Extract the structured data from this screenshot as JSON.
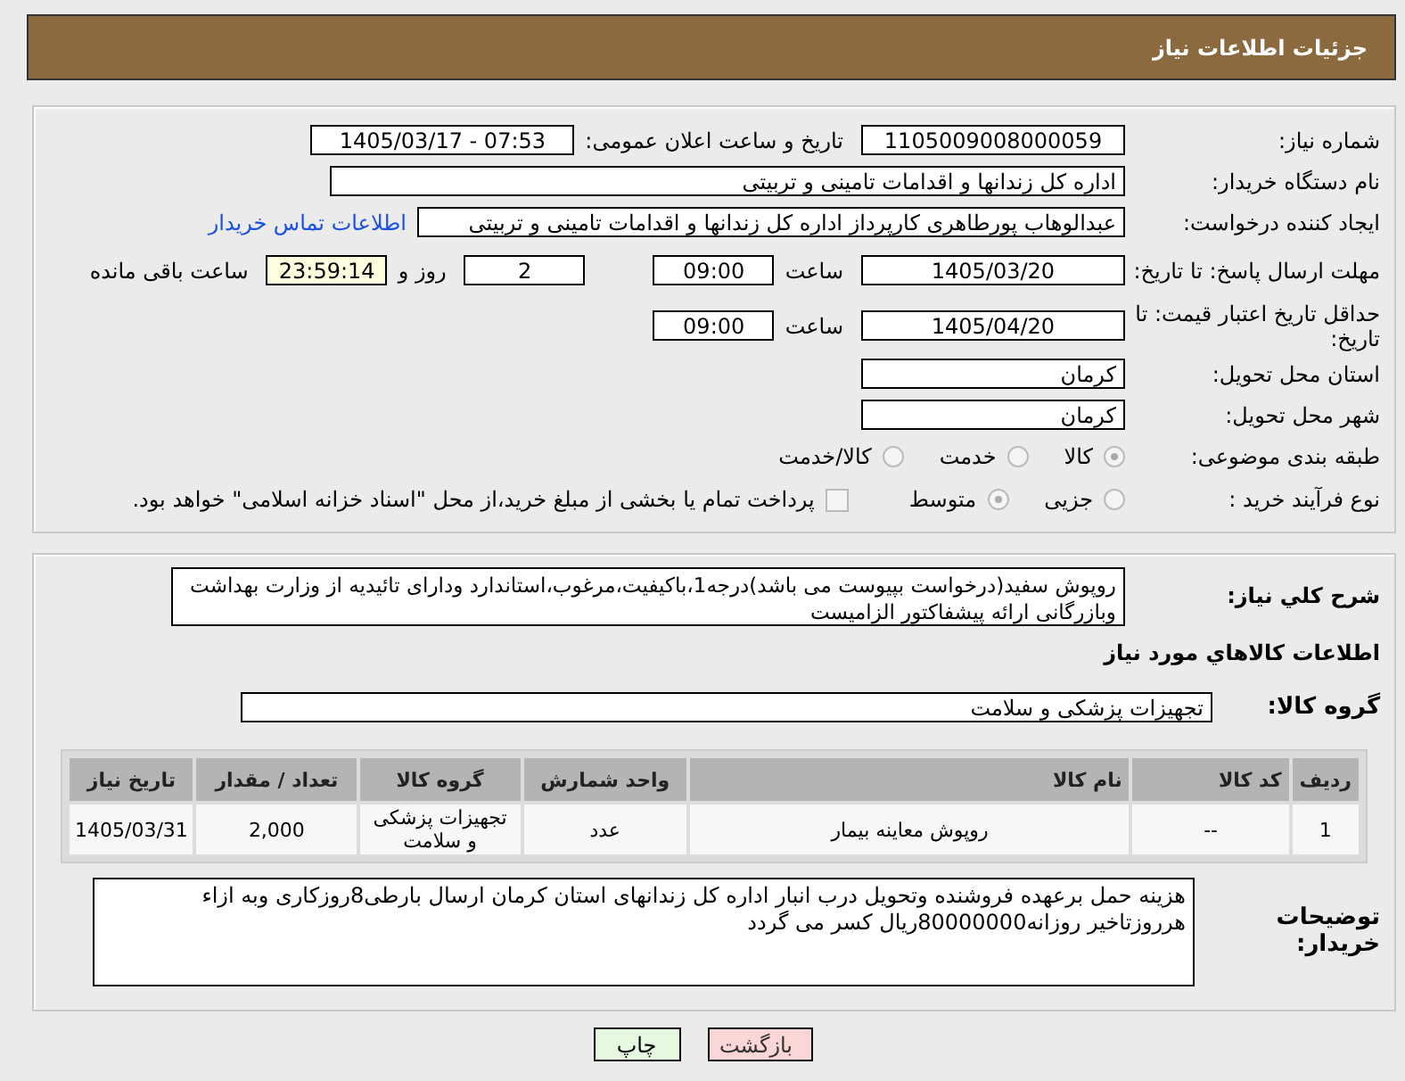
{
  "header": {
    "title": "جزئیات اطلاعات نیاز"
  },
  "need_number": {
    "label": "شماره نیاز:",
    "value": "1105009008000059"
  },
  "announce_date": {
    "label": "تاریخ و ساعت اعلان عمومی:",
    "value": "1405/03/17 - 07:53"
  },
  "buyer_org": {
    "label": "نام دستگاه خریدار:",
    "value": "اداره کل زندانها و اقدامات تامینی و تربیتی"
  },
  "requester": {
    "label": "ایجاد کننده درخواست:",
    "value": "عبدالوهاب پورطاهری کارپرداز اداره کل زندانها و اقدامات تامینی و تربیتی",
    "link": "اطلاعات تماس خریدار"
  },
  "response_deadline": {
    "label": "مهلت ارسال پاسخ: تا تاریخ:",
    "date": "1405/03/20",
    "time_label": "ساعت",
    "time": "09:00",
    "days": "2",
    "days_label": "روز و",
    "remaining": "23:59:14",
    "remaining_label": "ساعت باقی مانده"
  },
  "price_validity": {
    "label": "حداقل تاریخ اعتبار قیمت: تا تاریخ:",
    "date": "1405/04/20",
    "time_label": "ساعت",
    "time": "09:00"
  },
  "province": {
    "label": "استان محل تحویل:",
    "value": "کرمان"
  },
  "city": {
    "label": "شهر محل تحویل:",
    "value": "کرمان"
  },
  "subject_classification": {
    "label": "طبقه بندی موضوعی:",
    "options": [
      {
        "label": "کالا",
        "selected": true
      },
      {
        "label": "خدمت",
        "selected": false
      },
      {
        "label": "کالا/خدمت",
        "selected": false
      }
    ]
  },
  "purchase_process": {
    "label": "نوع فرآیند خرید :",
    "options": [
      {
        "label": "جزیی",
        "selected": false
      },
      {
        "label": "متوسط",
        "selected": true
      }
    ],
    "treasury": {
      "checked": false,
      "text": "پرداخت تمام یا بخشی از مبلغ خرید،از محل \"اسناد خزانه اسلامی\" خواهد بود."
    }
  },
  "description": {
    "label": "شرح کلي نياز:",
    "value": "روپوش سفید(درخواست بپیوست می باشد)درجه1،باکیفیت،مرغوب،استاندارد ودارای تائیدیه از وزارت بهداشت وبازرگانی ارائه پیشفاکتور الزامیست"
  },
  "goods_heading": "اطلاعات کالاهاي مورد نياز",
  "goods_group": {
    "label": "گروه کالا:",
    "value": "تجهیزات پزشکی و سلامت"
  },
  "table": {
    "columns": [
      "ردیف",
      "کد کالا",
      "نام کالا",
      "واحد شمارش",
      "گروه کالا",
      "تعداد / مقدار",
      "تاریخ نیاز"
    ],
    "rows": [
      [
        "1",
        "--",
        "روپوش معاینه بیمار",
        "عدد",
        "تجهیزات پزشکی و سلامت",
        "2,000",
        "1405/03/31"
      ]
    ]
  },
  "buyer_notes": {
    "label": "توضیحات خریدار:",
    "value": "هزینه حمل برعهده فروشنده وتحویل درب انبار اداره کل زندانهای استان کرمان ارسال بارطی8روزکاری وبه ازاء هرروزتاخیر روزانه80000000ریال کسر می گردد"
  },
  "buttons": [
    {
      "label": "بازگشت",
      "kind": "back"
    },
    {
      "label": "چاپ",
      "kind": "print"
    }
  ]
}
